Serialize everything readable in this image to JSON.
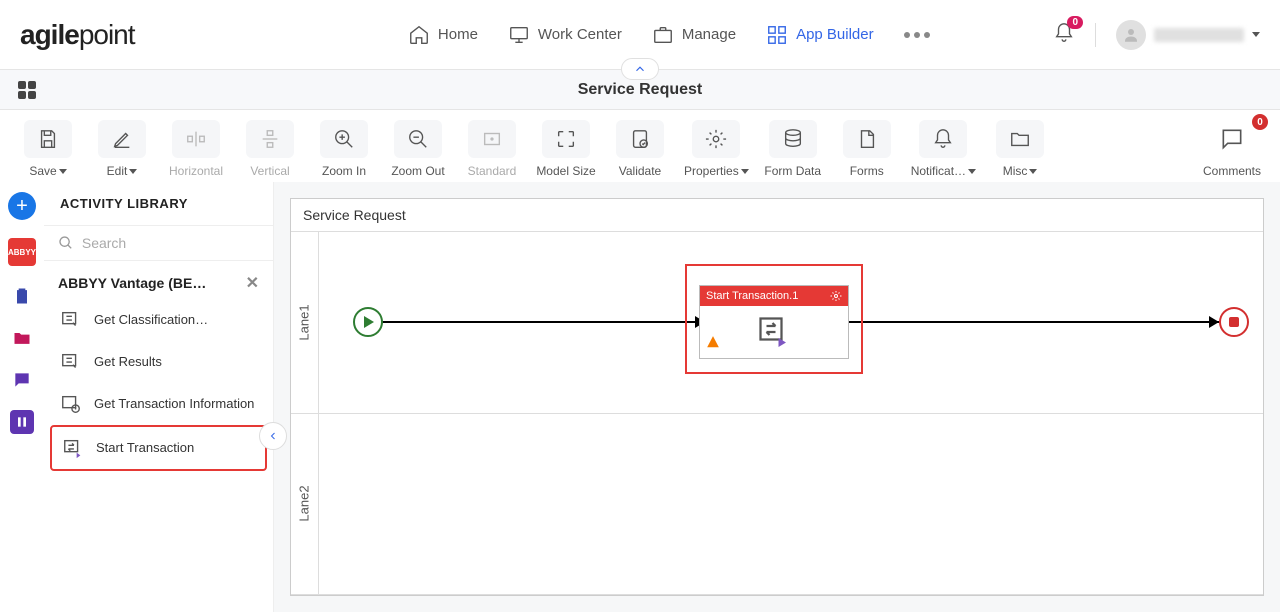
{
  "logo": {
    "agile": "agile",
    "point": "point"
  },
  "topnav": {
    "home": "Home",
    "workcenter": "Work Center",
    "manage": "Manage",
    "appbuilder": "App Builder"
  },
  "notifications_badge": "0",
  "doc_title": "Service Request",
  "toolbar": {
    "save": "Save",
    "edit": "Edit",
    "horizontal": "Horizontal",
    "vertical": "Vertical",
    "zoomin": "Zoom In",
    "zoomout": "Zoom Out",
    "standard": "Standard",
    "modelsize": "Model Size",
    "validate": "Validate",
    "properties": "Properties",
    "formdata": "Form Data",
    "forms": "Forms",
    "notifications": "Notificat…",
    "misc": "Misc",
    "comments": "Comments",
    "comments_count": "0"
  },
  "sidebar": {
    "title": "ACTIVITY LIBRARY",
    "search_placeholder": "Search",
    "category": "ABBYY Vantage (BE…",
    "items": {
      "get_classification": "Get Classification…",
      "get_results": "Get Results",
      "get_transaction_info": "Get Transaction Information",
      "start_transaction": "Start Transaction"
    }
  },
  "rail": {
    "abbyy": "ABBYY"
  },
  "canvas": {
    "title": "Service Request",
    "lane1": "Lane1",
    "lane2": "Lane2",
    "activity_name": "Start Transaction.1"
  }
}
